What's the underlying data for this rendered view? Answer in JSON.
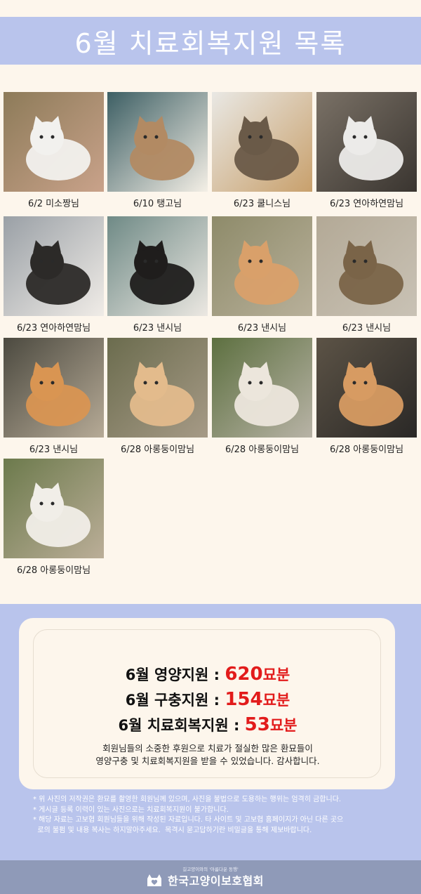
{
  "page": {
    "title": "6월 치료회복지원 목록"
  },
  "cats": [
    {
      "caption": "6/2 미소짱님",
      "palette": [
        "#8d7b59",
        "#f2f1ee",
        "#c9a28a"
      ]
    },
    {
      "caption": "6/10 탱고님",
      "palette": [
        "#3d5f64",
        "#b28a63",
        "#f4efe6"
      ]
    },
    {
      "caption": "6/23 쿨니스님",
      "palette": [
        "#e9e8e4",
        "#6a5a48",
        "#c8a06c"
      ]
    },
    {
      "caption": "6/23 연아하연맘님",
      "palette": [
        "#7a7166",
        "#ecebe9",
        "#3a3530"
      ]
    },
    {
      "caption": "6/23 연아하연맘님",
      "palette": [
        "#9aa0a6",
        "#2c2a28",
        "#f0ece7"
      ]
    },
    {
      "caption": "6/23 낸시님",
      "palette": [
        "#6f8a86",
        "#1f1d1c",
        "#ece8e2"
      ]
    },
    {
      "caption": "6/23 낸시님",
      "palette": [
        "#8e8b6a",
        "#d9a06a",
        "#b8b09a"
      ]
    },
    {
      "caption": "6/23 낸시님",
      "palette": [
        "#b3a996",
        "#7a6448",
        "#c9c2b5"
      ]
    },
    {
      "caption": "6/23 낸시님",
      "palette": [
        "#4c4a40",
        "#d99552",
        "#b6aa96"
      ]
    },
    {
      "caption": "6/28 아롱둥이맘님",
      "palette": [
        "#6b6c4e",
        "#e3bb8c",
        "#a69a86"
      ]
    },
    {
      "caption": "6/28 아롱둥이맘님",
      "palette": [
        "#5d7040",
        "#ece6dc",
        "#b8b3a6"
      ]
    },
    {
      "caption": "6/28 아롱둥이맘님",
      "palette": [
        "#5c5346",
        "#d79b62",
        "#2a2826"
      ]
    },
    {
      "caption": "6/28 아롱둥이맘님",
      "palette": [
        "#6c7a4c",
        "#f1eee8",
        "#bbae98"
      ]
    }
  ],
  "summary": {
    "lines": [
      {
        "label": "6월 영양지원 : ",
        "number": "620",
        "unit": "묘분"
      },
      {
        "label": "6월 구충지원 : ",
        "number": "154",
        "unit": "묘분"
      },
      {
        "label": "6월 치료회복지원 : ",
        "number": "53",
        "unit": "묘분"
      }
    ],
    "thanks_line1": "회원님들의 소중한 후원으로 치료가 절실한 많은 환묘들이",
    "thanks_line2": "영양구충 및 치료회복지원을 받을 수 있었습니다. 감사합니다."
  },
  "notes": [
    "* 위 사진의 저작권은 환묘를 촬영한 회원님께 있으며, 사진을 불법으로 도용하는 행위는 엄격히 금합니다.",
    "* 게시글 등록 이력이 있는 사진으로는 치료회복지원이 불가합니다.",
    "* 해당 자료는 고보협 회원님들을 위해 작성된 자료입니다. 타 사이트 및 고보협 홈페이지가 아닌 다른 곳으",
    "  로의 불펌 및 내용 복사는 하지말아주세요.  목격시 묻고답하기란 비밀글을 통해 제보바랍니다."
  ],
  "footer": {
    "tagline": "길고양이와의  '아름다운 동행'",
    "org_name": "한국고양이보호협회",
    "logo_icon": "cat-heart-logo-icon"
  },
  "colors": {
    "band": "#b9c4ec",
    "background": "#fdf6ec",
    "accent_red": "#e21b1b",
    "footer": "#8f9ab8"
  }
}
